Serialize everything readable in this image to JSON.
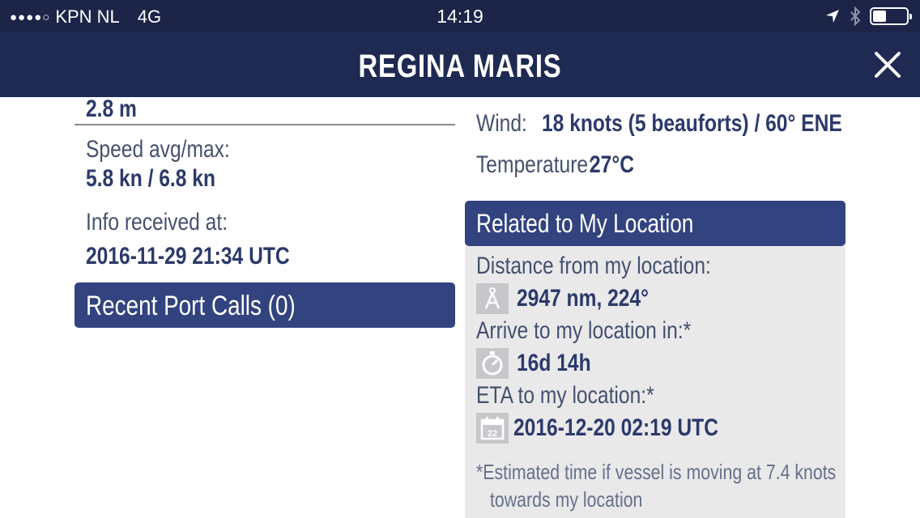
{
  "status_bar": {
    "signal": "●●●●○",
    "carrier": "KPN NL",
    "network": "4G",
    "time": "14:19",
    "icons": [
      "location-arrow-icon",
      "bluetooth-icon",
      "battery-icon"
    ],
    "battery_level": 0.4
  },
  "nav": {
    "title": "REGINA MARIS",
    "close_icon": "close-icon"
  },
  "left": {
    "draught_value": "2.8 m",
    "speed_label": "Speed avg/max:",
    "speed_value": "5.8 kn / 6.8 kn",
    "info_label": "Info received at:",
    "info_value": "2016-11-29 21:34 UTC",
    "port_calls_label": "Recent Port Calls (0)"
  },
  "right": {
    "wind_label": "Wind:",
    "wind_value": "18 knots (5 beauforts) / 60° ENE",
    "temp_label": "Temperature:",
    "temp_value": "27°C",
    "related_title": "Related to My Location",
    "distance_label": "Distance from my location:",
    "distance_value": "2947 nm, 224°",
    "arrive_label": "Arrive to my location in:*",
    "arrive_value": "16d 14h",
    "eta_label": "ETA to my location:*",
    "eta_value": "2016-12-20 02:19 UTC",
    "calendar_day": "22",
    "note_line1": "*Estimated time if vessel is moving  at 7.4 knots",
    "note_line2": "towards my location"
  },
  "colors": {
    "status_bg": "#1c2548",
    "nav_bg": "#1e2a52",
    "section_bar": "#33437f",
    "value_text": "#2c3a6b",
    "label_text": "#44506e",
    "panel_bg": "#e9e9ea"
  }
}
